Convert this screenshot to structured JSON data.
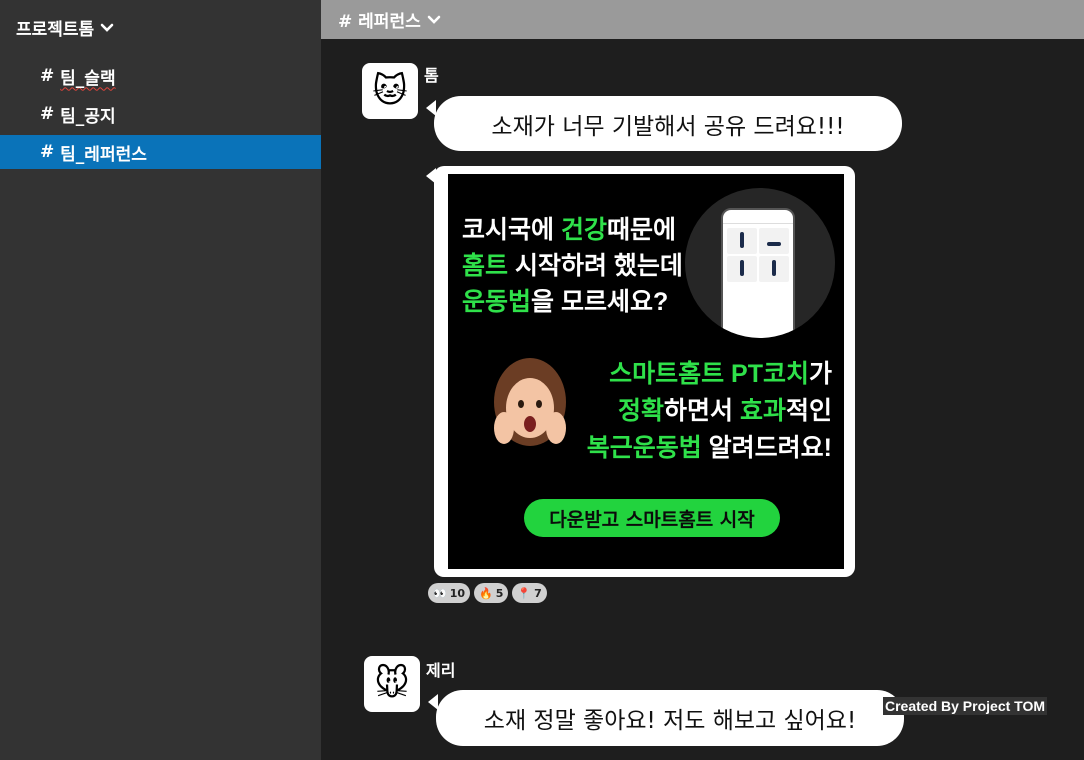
{
  "sidebar": {
    "workspace_name": "프로젝트톰",
    "channels": [
      {
        "hash": "#",
        "label": "팀_슬랙"
      },
      {
        "hash": "#",
        "label": "팀_공지"
      },
      {
        "hash": "#",
        "label": "팀_레퍼런스"
      }
    ],
    "active_channel_color": "#0a73b9"
  },
  "header": {
    "channel": "# 레퍼런스"
  },
  "messages": [
    {
      "author": "톰",
      "avatar_icon": "cat-face-icon",
      "avatar_glyph": "🐱",
      "text": "소재가 너무 기발해서 공유 드려요!!!"
    },
    {
      "author": "제리",
      "avatar_icon": "mouse-face-icon",
      "avatar_glyph": "🐭",
      "text": "소재 정말 좋아요! 저도 해보고 싶어요!"
    }
  ],
  "ad_image": {
    "line1a": "코시국에 ",
    "line1b": "건강",
    "line1c": "때문에",
    "line2a": "홈트",
    "line2b": " 시작하려 했는데",
    "line3a": "운동법",
    "line3b": "을 모르세요?",
    "line4a": "스마트홈트 PT코치",
    "line4b": "가",
    "line5a": "정확",
    "line5b": "하면서 ",
    "line5c": "효과",
    "line5d": "적인",
    "line6a": "복근운동법",
    "line6b": " 알려드려요!",
    "button": "다운받고 스마트홈트 시작",
    "accent_color": "#2fe14a"
  },
  "reactions": [
    {
      "icon": "eyes-icon",
      "glyph": "👀",
      "count": "10"
    },
    {
      "icon": "fire-icon",
      "glyph": "🔥",
      "count": "5"
    },
    {
      "icon": "pushpin-icon",
      "glyph": "📍",
      "count": "7"
    }
  ],
  "watermark": "Created By Project TOM"
}
